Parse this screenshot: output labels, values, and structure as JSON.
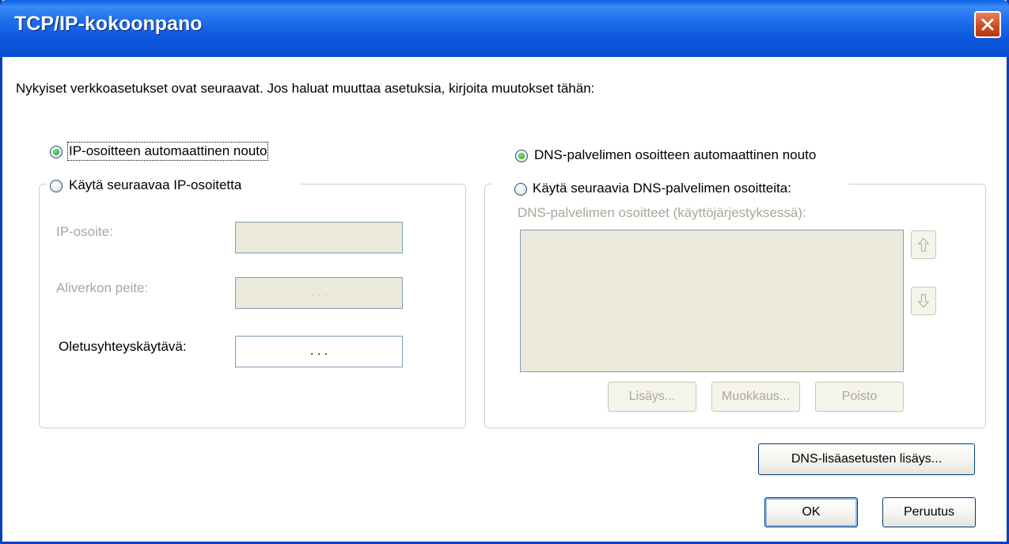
{
  "window": {
    "title": "TCP/IP-kokoonpano"
  },
  "intro": "Nykyiset verkkoasetukset ovat seuraavat. Jos haluat muuttaa asetuksia, kirjoita muutokset tähän:",
  "ip": {
    "auto_label": "IP-osoitteen automaattinen nouto",
    "auto_selected": true,
    "manual_label": "Käytä seuraavaa IP-osoitetta",
    "fields": [
      {
        "label": "IP-osoite:",
        "value": ".   .   .",
        "enabled": false
      },
      {
        "label": "Aliverkon peite:",
        "value": ".   .   .",
        "enabled": false
      },
      {
        "label": "Oletusyhteyskäytävä:",
        "value": ".   .   .",
        "enabled": true
      }
    ]
  },
  "dns": {
    "auto_label": "DNS-palvelimen osoitteen automaattinen nouto",
    "auto_selected": true,
    "manual_label": "Käytä seuraavia DNS-palvelimen osoitteita:",
    "list_label": "DNS-palvelimen osoitteet (käyttöjärjestyksessä):",
    "buttons": {
      "add": "Lisäys...",
      "edit": "Muokkaus...",
      "remove": "Poisto"
    },
    "advanced_button": "DNS-lisäasetusten lisäys..."
  },
  "footer": {
    "ok": "OK",
    "cancel": "Peruutus"
  }
}
